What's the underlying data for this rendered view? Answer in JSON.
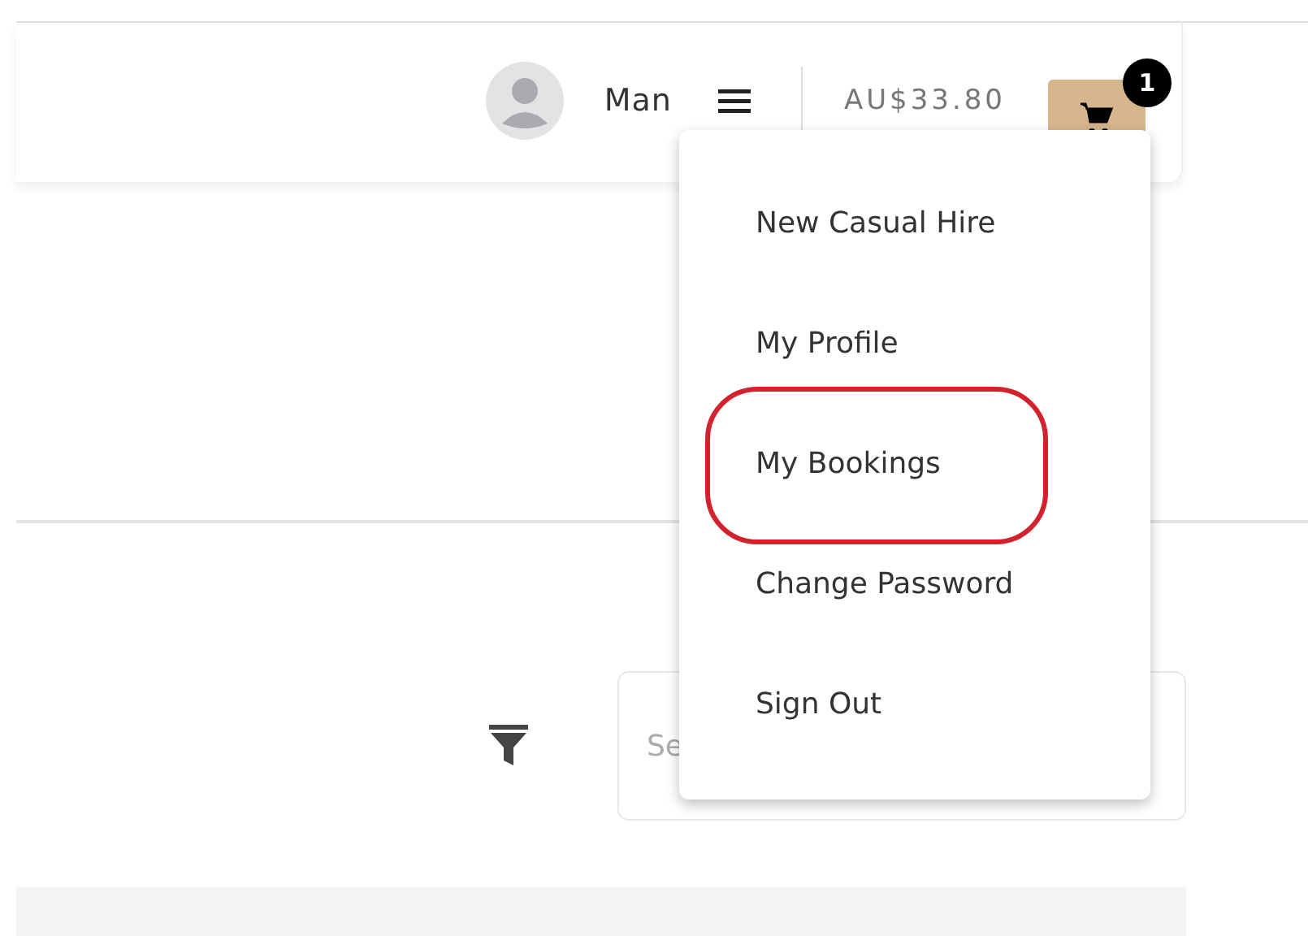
{
  "header": {
    "user_name": "Man",
    "balance": "AU$33.80",
    "cart_count": "1"
  },
  "user_menu": {
    "items": [
      {
        "label": "New Casual Hire",
        "annotated": false
      },
      {
        "label": "My Profile",
        "annotated": false
      },
      {
        "label": "My Bookings",
        "annotated": true
      },
      {
        "label": "Change Password",
        "annotated": false
      },
      {
        "label": "Sign Out",
        "annotated": false
      }
    ]
  },
  "toolbar": {
    "search": {
      "placeholder": "Se"
    }
  }
}
